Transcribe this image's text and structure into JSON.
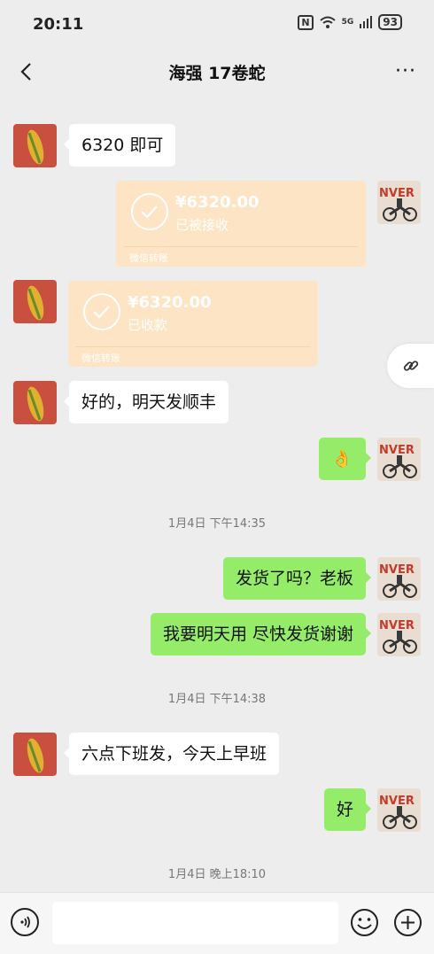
{
  "status": {
    "time": "20:11",
    "network": "5G",
    "battery": "93"
  },
  "nav": {
    "title": "海强 17卷蛇",
    "more": "···"
  },
  "messages": {
    "m1": "6320 即可",
    "transfer1": {
      "amount": "¥6320.00",
      "status": "已被接收",
      "footer": "微信转账"
    },
    "transfer2": {
      "amount": "¥6320.00",
      "status": "已收款",
      "footer": "微信转账"
    },
    "m2": "好的，明天发顺丰",
    "m3_emoji": "👌",
    "ts1": "1月4日 下午14:35",
    "m4": "发货了吗？老板",
    "m5": "我要明天用 尽快发货谢谢",
    "ts2": "1月4日 下午14:38",
    "m6": "六点下班发，今天上早班",
    "m7": "好",
    "ts3": "1月4日 晚上18:10"
  },
  "input": {
    "value": "",
    "placeholder": ""
  },
  "colors": {
    "background": "#ededed",
    "self_bubble": "#95ec69",
    "other_bubble": "#ffffff",
    "transfer_card": "#fde4c4"
  },
  "icons": {
    "back": "back-arrow-icon",
    "more": "more-icon",
    "link": "link-icon",
    "voice": "voice-icon",
    "emoji": "emoji-icon",
    "plus": "plus-icon"
  }
}
